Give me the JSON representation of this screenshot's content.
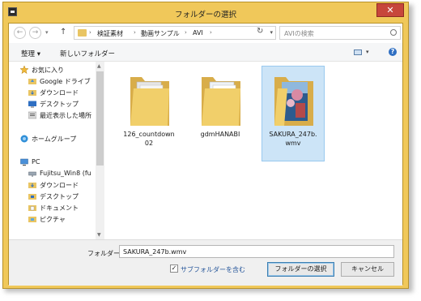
{
  "window": {
    "title": "フォルダーの選択",
    "close_glyph": "✕"
  },
  "navigation": {
    "back_glyph": "←",
    "forward_glyph": "→",
    "history_glyph": "▾",
    "up_glyph": "↑",
    "breadcrumbs": [
      "検証素材",
      "動画サンプル",
      "AVI"
    ],
    "breadcrumb_sep": "›",
    "address_dropdown_glyph": "▾",
    "refresh_glyph": "↻",
    "search_placeholder": "AVIの検索"
  },
  "toolbar": {
    "organize_label": "整理 ▾",
    "new_folder_label": "新しいフォルダー",
    "view_dropdown_glyph": "▾",
    "help_glyph": "?"
  },
  "sidebar": {
    "favorites": {
      "label": "お気に入り",
      "items": [
        "Google ドライブ",
        "ダウンロード",
        "デスクトップ",
        "最近表示した場所"
      ]
    },
    "homegroup": {
      "label": "ホームグループ"
    },
    "pc": {
      "label": "PC",
      "items": [
        "Fujitsu_Win8 (fu",
        "ダウンロード",
        "デスクトップ",
        "ドキュメント",
        "ピクチャ"
      ]
    }
  },
  "files": [
    {
      "name_line1": "126_countdown",
      "name_line2": "02",
      "selected": false
    },
    {
      "name_line1": "gdmHANABI",
      "name_line2": "",
      "selected": false
    },
    {
      "name_line1": "SAKURA_247b.",
      "name_line2": "wmv",
      "selected": true
    }
  ],
  "footer": {
    "folder_label": "フォルダー:",
    "folder_value": "SAKURA_247b.wmv",
    "include_subfolders_label": "サブフォルダーを含む",
    "include_subfolders_checked": true,
    "checkmark_glyph": "✓",
    "select_button": "フォルダーの選択",
    "cancel_button": "キャンセル"
  },
  "colors": {
    "frame": "#f0c85a",
    "close": "#c7463b",
    "selection": "#cce4f7",
    "folder": "#e9c563"
  }
}
